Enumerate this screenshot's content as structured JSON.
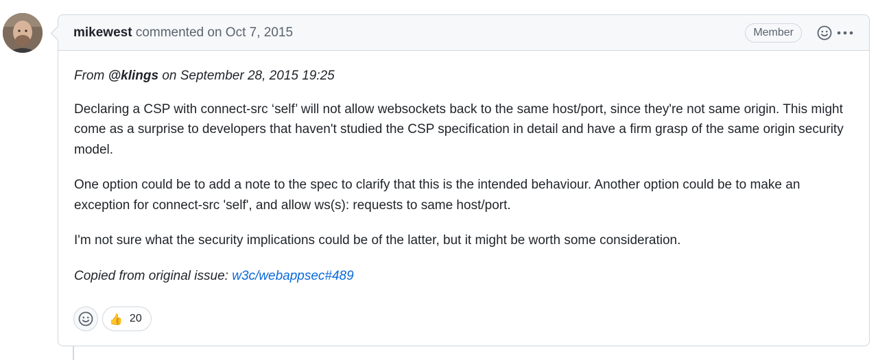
{
  "comment": {
    "author": "mikewest",
    "action": "commented on",
    "date": "Oct 7, 2015",
    "role_badge": "Member",
    "icons": {
      "avatar": "user-avatar",
      "add_reaction": "smiley-icon",
      "more": "kebab-horizontal-icon"
    },
    "body": {
      "from_prefix": "From",
      "from_user": "@klings",
      "from_suffix": "on September 28, 2015 19:25",
      "paragraph_1": "Declaring a CSP with connect-src ‘self’ will not allow websockets back to the same host/port, since they're not same origin. This might come as a surprise to developers that haven't studied the CSP specification in detail and have a firm grasp of the same origin security model.",
      "paragraph_2": "One option could be to add a note to the spec to clarify that this is the intended behaviour. Another option could be to make an exception for connect-src 'self', and allow ws(s): requests to same host/port.",
      "paragraph_3": "I'm not sure what the security implications could be of the latter, but it might be worth some consideration.",
      "copied_prefix": "Copied from original issue:",
      "copied_link": "w3c/webappsec#489"
    },
    "reactions": [
      {
        "emoji": "👍",
        "icon": "thumbs-up-icon",
        "count": "20"
      }
    ]
  },
  "colors": {
    "link": "#0969da",
    "border": "#d0d7de",
    "header_bg": "#f6f8fa",
    "muted_text": "#59636e"
  }
}
